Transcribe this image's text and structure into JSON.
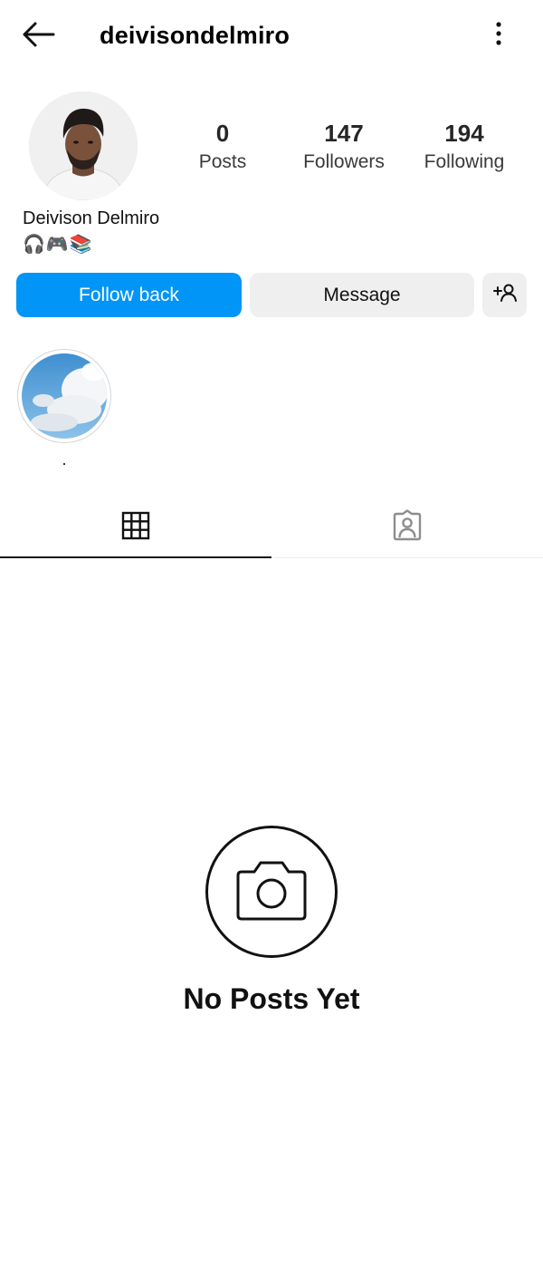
{
  "header": {
    "username": "deivisondelmiro"
  },
  "profile": {
    "full_name": "Deivison Delmiro",
    "bio_emojis": [
      "🎧",
      "🎮",
      "📚"
    ]
  },
  "stats": {
    "posts": {
      "value": "0",
      "label": "Posts"
    },
    "followers": {
      "value": "147",
      "label": "Followers"
    },
    "following": {
      "value": "194",
      "label": "Following"
    }
  },
  "actions": {
    "follow_back": "Follow back",
    "message": "Message"
  },
  "highlights": [
    {
      "label": "."
    }
  ],
  "empty_state": {
    "title": "No Posts Yet"
  },
  "colors": {
    "primary": "#0095f6",
    "secondary_button": "#efefef"
  }
}
